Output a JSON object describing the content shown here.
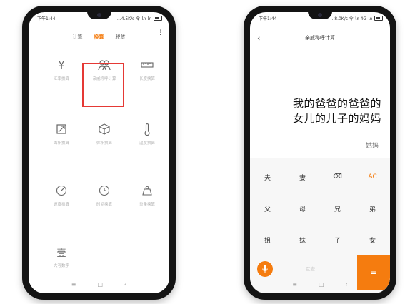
{
  "left_phone": {
    "status_time": "下午1:44",
    "status_right": "...4.5K/s 令 ㏑ ㏑",
    "tabs": [
      "计算",
      "换算",
      "税贷"
    ],
    "active_tab": "换算",
    "more_label": "⋮",
    "tools": [
      {
        "icon": "yen-icon",
        "glyph": "¥",
        "label": "汇率换算"
      },
      {
        "icon": "people-icon",
        "glyph": "",
        "label": "亲戚称呼计算"
      },
      {
        "icon": "ruler-icon",
        "glyph": "",
        "label": "长度换算"
      },
      {
        "icon": "area-icon",
        "glyph": "",
        "label": "面积换算"
      },
      {
        "icon": "cube-icon",
        "glyph": "",
        "label": "体积换算"
      },
      {
        "icon": "thermometer-icon",
        "glyph": "",
        "label": "温度换算"
      },
      {
        "icon": "speed-icon",
        "glyph": "",
        "label": "速度换算"
      },
      {
        "icon": "clock-icon",
        "glyph": "",
        "label": "时间换算"
      },
      {
        "icon": "weight-icon",
        "glyph": "",
        "label": "重量换算"
      },
      {
        "icon": "capital-icon",
        "glyph": "壹",
        "label": "大写数字"
      }
    ],
    "nav": [
      "≡",
      "□",
      "‹"
    ]
  },
  "right_phone": {
    "status_time": "下午1:44",
    "status_right": "...8.0K/s 令 ㏑ 4G ㏑",
    "title": "亲戚称呼计算",
    "back_label": "‹",
    "expression_line1": "我的爸爸的爸爸的",
    "expression_line2": "女儿的儿子的妈妈",
    "result": "姑妈",
    "keys": [
      [
        "夫",
        "妻",
        "⌫",
        "AC"
      ],
      [
        "父",
        "母",
        "兄",
        "弟"
      ],
      [
        "姐",
        "妹",
        "子",
        "女"
      ]
    ],
    "mutual_label": "互查",
    "equals_label": "=",
    "nav": [
      "≡",
      "□",
      "‹"
    ],
    "accent": "#f57c0f"
  }
}
